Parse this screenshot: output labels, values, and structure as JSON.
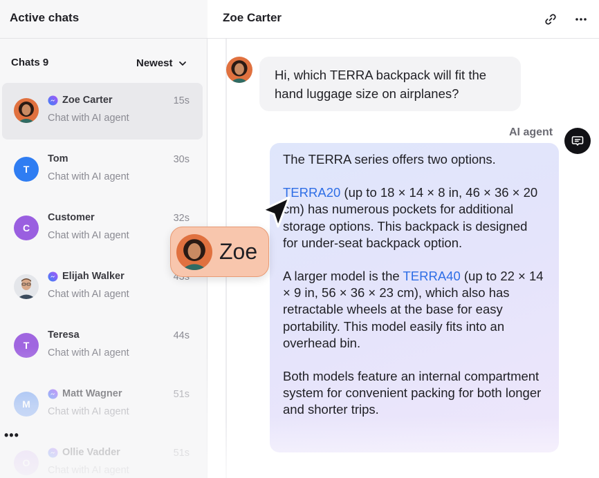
{
  "sidebar": {
    "title": "Active chats",
    "chats_count": "Chats 9",
    "sort": {
      "selected": "Newest"
    },
    "more_label": "•••",
    "chats": [
      {
        "name": "Zoe Carter",
        "subtitle": "Chat with AI agent",
        "time": "15s",
        "initial": "",
        "avatar_color": "#e27b4a",
        "messenger": true,
        "active": true,
        "photo": true
      },
      {
        "name": "Tom",
        "subtitle": "Chat with AI agent",
        "time": "30s",
        "initial": "T",
        "avatar_color": "#2f7df2",
        "messenger": false,
        "active": false
      },
      {
        "name": "Customer",
        "subtitle": "Chat with AI agent",
        "time": "32s",
        "initial": "C",
        "avatar_color": "#9a5fe0",
        "messenger": false,
        "active": false
      },
      {
        "name": "Elijah Walker",
        "subtitle": "Chat with AI agent",
        "time": "43s",
        "initial": "",
        "avatar_color": "#cfd3db",
        "messenger": true,
        "active": false,
        "photo": true
      },
      {
        "name": "Teresa",
        "subtitle": "Chat with AI agent",
        "time": "44s",
        "initial": "T",
        "avatar_color": "#a066e0",
        "messenger": false,
        "active": false
      },
      {
        "name": "Matt Wagner",
        "subtitle": "Chat with AI agent",
        "time": "51s",
        "initial": "M",
        "avatar_color": "#7fa8f2",
        "messenger": true,
        "active": false
      },
      {
        "name": "Ollie Vadder",
        "subtitle": "Chat with AI agent",
        "time": "51s",
        "initial": "O",
        "avatar_color": "#d6b8f2",
        "messenger": true,
        "active": false
      }
    ]
  },
  "conversation": {
    "title": "Zoe Carter",
    "customer_message": "Hi, which TERRA backpack will fit the hand luggage size on airplanes?",
    "agent_label": "AI agent",
    "agent_message": {
      "p1": "The TERRA series offers two options.",
      "p2_link": "TERRA20",
      "p2_text": " (up to 18 × 14 × 8 in, 46 × 36 × 20 cm) has numerous pockets for additional storage options. This backpack is designed for under-seat backpack option.",
      "p3_pre": "A larger model is the ",
      "p3_link": "TERRA40",
      "p3_text": " (up to 22 × 14 × 9 in, 56 × 36 × 23 cm), which also has retractable wheels at the base for easy portability. This model easily fits into an overhead bin.",
      "p4": "Both models feature an internal compartment system for convenient packing for both longer and shorter trips."
    }
  },
  "cursor_tag": {
    "name": "Zoe",
    "color": "#f8c6ad"
  },
  "colors": {
    "link": "#2e6ee6",
    "messenger_gradient_start": "#3b82f6",
    "messenger_gradient_end": "#a855f7"
  }
}
